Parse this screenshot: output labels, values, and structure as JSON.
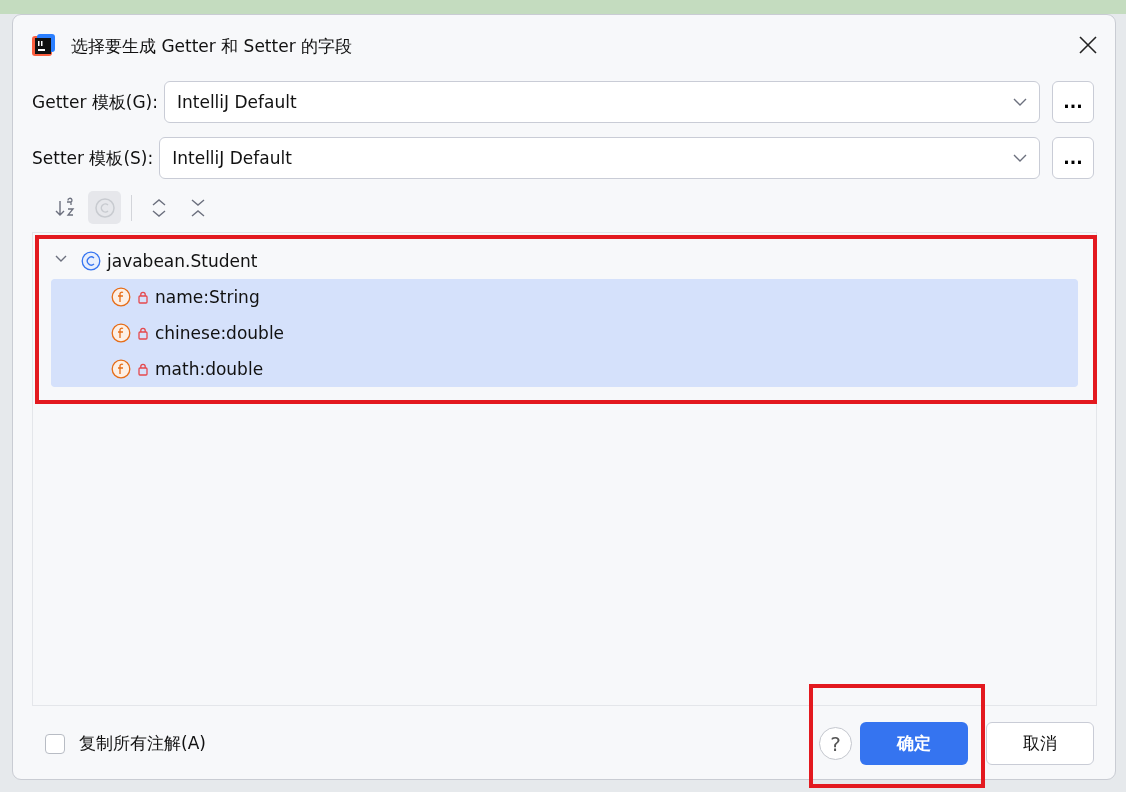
{
  "window": {
    "title": "选择要生成 Getter 和 Setter 的字段"
  },
  "templates": [
    {
      "label": "Getter 模板(G):",
      "value": "IntelliJ Default",
      "more": "..."
    },
    {
      "label": "Setter 模板(S):",
      "value": "IntelliJ Default",
      "more": "..."
    }
  ],
  "toolbar": [
    {
      "kind": "sort",
      "disabled": false,
      "selected": false
    },
    {
      "kind": "class",
      "disabled": true,
      "selected": true
    },
    {
      "kind": "expand",
      "disabled": false,
      "selected": false
    },
    {
      "kind": "collapse",
      "disabled": false,
      "selected": false
    }
  ],
  "tree": [
    {
      "label": "javabean.Student",
      "kind": "class",
      "expanded": true,
      "selected": false,
      "children": [
        {
          "label": "name:String",
          "kind": "field",
          "selected": true
        },
        {
          "label": "chinese:double",
          "kind": "field",
          "selected": true
        },
        {
          "label": "math:double",
          "kind": "field",
          "selected": true
        }
      ]
    }
  ],
  "copy_annotations": {
    "label": "复制所有注解(A)",
    "checked": false
  },
  "buttons": [
    {
      "label": "?",
      "kind": "help"
    },
    {
      "label": "确定",
      "kind": "primary"
    },
    {
      "label": "取消",
      "kind": "secondary"
    }
  ]
}
